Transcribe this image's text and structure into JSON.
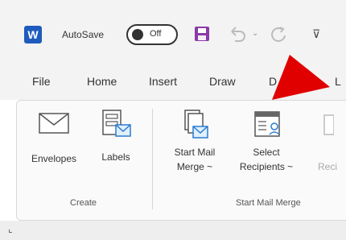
{
  "titlebar": {
    "app_icon": "word-icon",
    "app_icon_letter": "W",
    "autosave_label": "AutoSave",
    "toggle_state": "Off",
    "icons": [
      "save-icon",
      "undo-icon",
      "redo-icon",
      "more-icon"
    ],
    "undo_dropdown": "⌄",
    "more_symbol": "⊽"
  },
  "tabs": [
    "File",
    "Home",
    "Insert",
    "Draw",
    "D",
    "L"
  ],
  "ribbon": {
    "groups": [
      {
        "label": "Create",
        "buttons": [
          {
            "label": "Envelopes",
            "icon": "envelope-icon"
          },
          {
            "label": "Labels",
            "icon": "labels-icon"
          }
        ]
      },
      {
        "label": "Start Mail Merge",
        "buttons": [
          {
            "line1": "Start Mail",
            "line2": "Merge ~",
            "icon": "start-mail-merge-icon"
          },
          {
            "line1": "Select",
            "line2": "Recipients ~",
            "icon": "select-recipients-icon"
          },
          {
            "line1": "",
            "line2": "Reci",
            "icon": "edit-recipients-icon"
          }
        ]
      }
    ]
  },
  "annotation": {
    "color": "#e00000",
    "icon": "red-pointer-arrow"
  },
  "footer": {
    "mark": "⌞"
  },
  "colors": {
    "accent_word": "#1e5bbd",
    "save_purple": "#8a3aa8"
  }
}
